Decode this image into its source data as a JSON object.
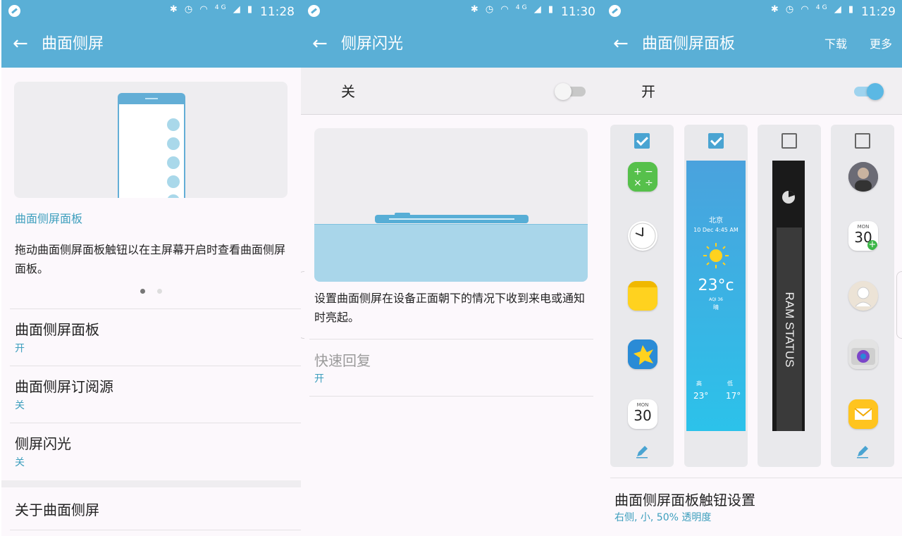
{
  "colors": {
    "bar": "#5aafd6",
    "accent": "#3c9ebd",
    "switch_on": "#5bb8e4",
    "switch_off": "#c8c8c8"
  },
  "status_icons": [
    "bluetooth-icon",
    "alarm-icon",
    "wifi-icon",
    "lte-icon",
    "signal-icon",
    "battery-charging-icon"
  ],
  "status_net": "4G",
  "panel1": {
    "time": "11:28",
    "title": "曲面侧屏",
    "feature_title": "曲面侧屏面板",
    "feature_desc": "拖动曲面侧屏面板触钮以在主屏幕开启时查看曲面侧屏面板。",
    "pager_current": 1,
    "pager_total": 2,
    "items": [
      {
        "title": "曲面侧屏面板",
        "value": "开"
      },
      {
        "title": "曲面侧屏订阅源",
        "value": "关"
      },
      {
        "title": "侧屏闪光",
        "value": "关"
      }
    ],
    "about": "关于曲面侧屏"
  },
  "panel2": {
    "time": "11:30",
    "title": "侧屏闪光",
    "switch_label": "关",
    "switch_on": false,
    "desc": "设置曲面侧屏在设备正面朝下的情况下收到来电或通知时亮起。",
    "quick_reply_title": "快速回复",
    "quick_reply_value": "开"
  },
  "panel3": {
    "time": "11:29",
    "title": "曲面侧屏面板",
    "download": "下载",
    "more": "更多",
    "switch_label": "开",
    "switch_on": true,
    "panels": [
      {
        "checked": true,
        "kind": "apps",
        "icons": [
          "calculator-icon",
          "clock-icon",
          "memo-icon",
          "gallery-icon",
          "calendar-icon"
        ],
        "calendar_month": "MON",
        "calendar_day": "30"
      },
      {
        "checked": true,
        "kind": "weather",
        "city": "北京",
        "datetime": "10 Dec 4:45 AM",
        "temp": "23°c",
        "aqi": "AQI 36",
        "condition": "晴",
        "high_label": "高",
        "low_label": "低",
        "high": "23°",
        "low": "17°"
      },
      {
        "checked": false,
        "kind": "ram",
        "label": "RAM STATUS"
      },
      {
        "checked": false,
        "kind": "people",
        "icons": [
          "contact-photo-icon",
          "calendar-add-icon",
          "contact-avatar-icon",
          "camera-icon",
          "email-icon"
        ],
        "calendar_month": "MON",
        "calendar_day": "30"
      }
    ],
    "handle_title": "曲面侧屏面板触钮设置",
    "handle_sub": "右侧, 小, 50% 透明度"
  }
}
